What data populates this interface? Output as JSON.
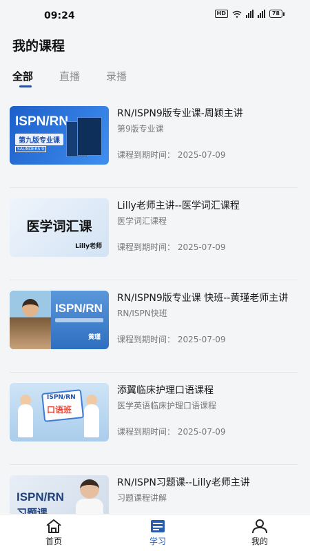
{
  "status_bar": {
    "time": "09:24",
    "hd": "HD",
    "signal1": "5G",
    "signal2": "4G",
    "battery": "78"
  },
  "page": {
    "title": "我的课程"
  },
  "tabs": [
    {
      "label": "全部",
      "active": true
    },
    {
      "label": "直播",
      "active": false
    },
    {
      "label": "录播",
      "active": false
    }
  ],
  "courses": [
    {
      "title": "RN/ISPN9版专业课-周颖主讲",
      "subtitle": "第9版专业课",
      "expire": "课程到期时间：  2025-07-09",
      "thumb": {
        "heading": "ISPN/RN",
        "pill": "第九版专业课",
        "small": "SAUNDERS 9"
      }
    },
    {
      "title": "Lilly老师主讲--医学词汇课程",
      "subtitle": "医学词汇课程",
      "expire": "课程到期时间：  2025-07-09",
      "thumb": {
        "heading": "医学词汇课",
        "tag": "Lilly老师"
      }
    },
    {
      "title": "RN/ISPN9版专业课 快班--黄瑾老师主讲",
      "subtitle": "RN/ISPN快班",
      "expire": "课程到期时间：  2025-07-09",
      "thumb": {
        "heading": "ISPN/RN",
        "name": "黄瑾"
      }
    },
    {
      "title": "添翼临床护理口语课程",
      "subtitle": "医学英语临床护理口语课程",
      "expire": "课程到期时间：  2025-07-09",
      "thumb": {
        "line1": "ISPN/RN",
        "line2": "口语班"
      }
    },
    {
      "title": "RN/ISPN习题课--Lilly老师主讲",
      "subtitle": "习题课程讲解",
      "expire": "",
      "thumb": {
        "heading": "ISPN/RN",
        "heading2": "习题课"
      }
    }
  ],
  "bottom_nav": [
    {
      "label": "首页",
      "icon": "home-icon",
      "active": false
    },
    {
      "label": "学习",
      "icon": "study-icon",
      "active": true
    },
    {
      "label": "我的",
      "icon": "user-icon",
      "active": false
    }
  ],
  "colors": {
    "accent": "#2a4f9e",
    "background": "#f4f5f7"
  }
}
